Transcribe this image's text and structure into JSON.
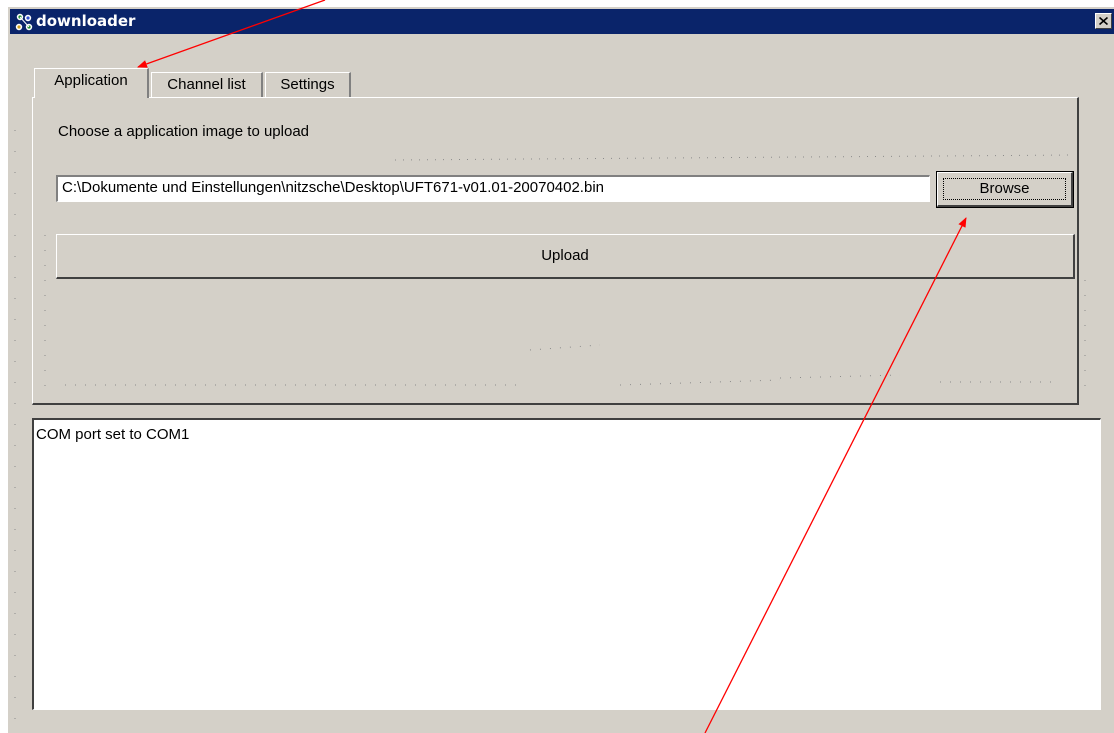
{
  "window": {
    "title": "downloader",
    "app_icon": "network-nodes-icon",
    "close_icon": "close-icon"
  },
  "tabs": [
    {
      "label": "Application",
      "active": true
    },
    {
      "label": "Channel list",
      "active": false
    },
    {
      "label": "Settings",
      "active": false
    }
  ],
  "application_tab": {
    "prompt": "Choose a application image to upload",
    "file_path": "C:\\Dokumente und Einstellungen\\nitzsche\\Desktop\\UFT671-v01.01-20070402.bin",
    "browse_label": "Browse",
    "upload_label": "Upload"
  },
  "log": {
    "lines": [
      "COM port set to COM1"
    ]
  },
  "colors": {
    "titlebar": "#0a246a",
    "face": "#d4d0c8",
    "annotation_arrow": "#ff0000"
  }
}
